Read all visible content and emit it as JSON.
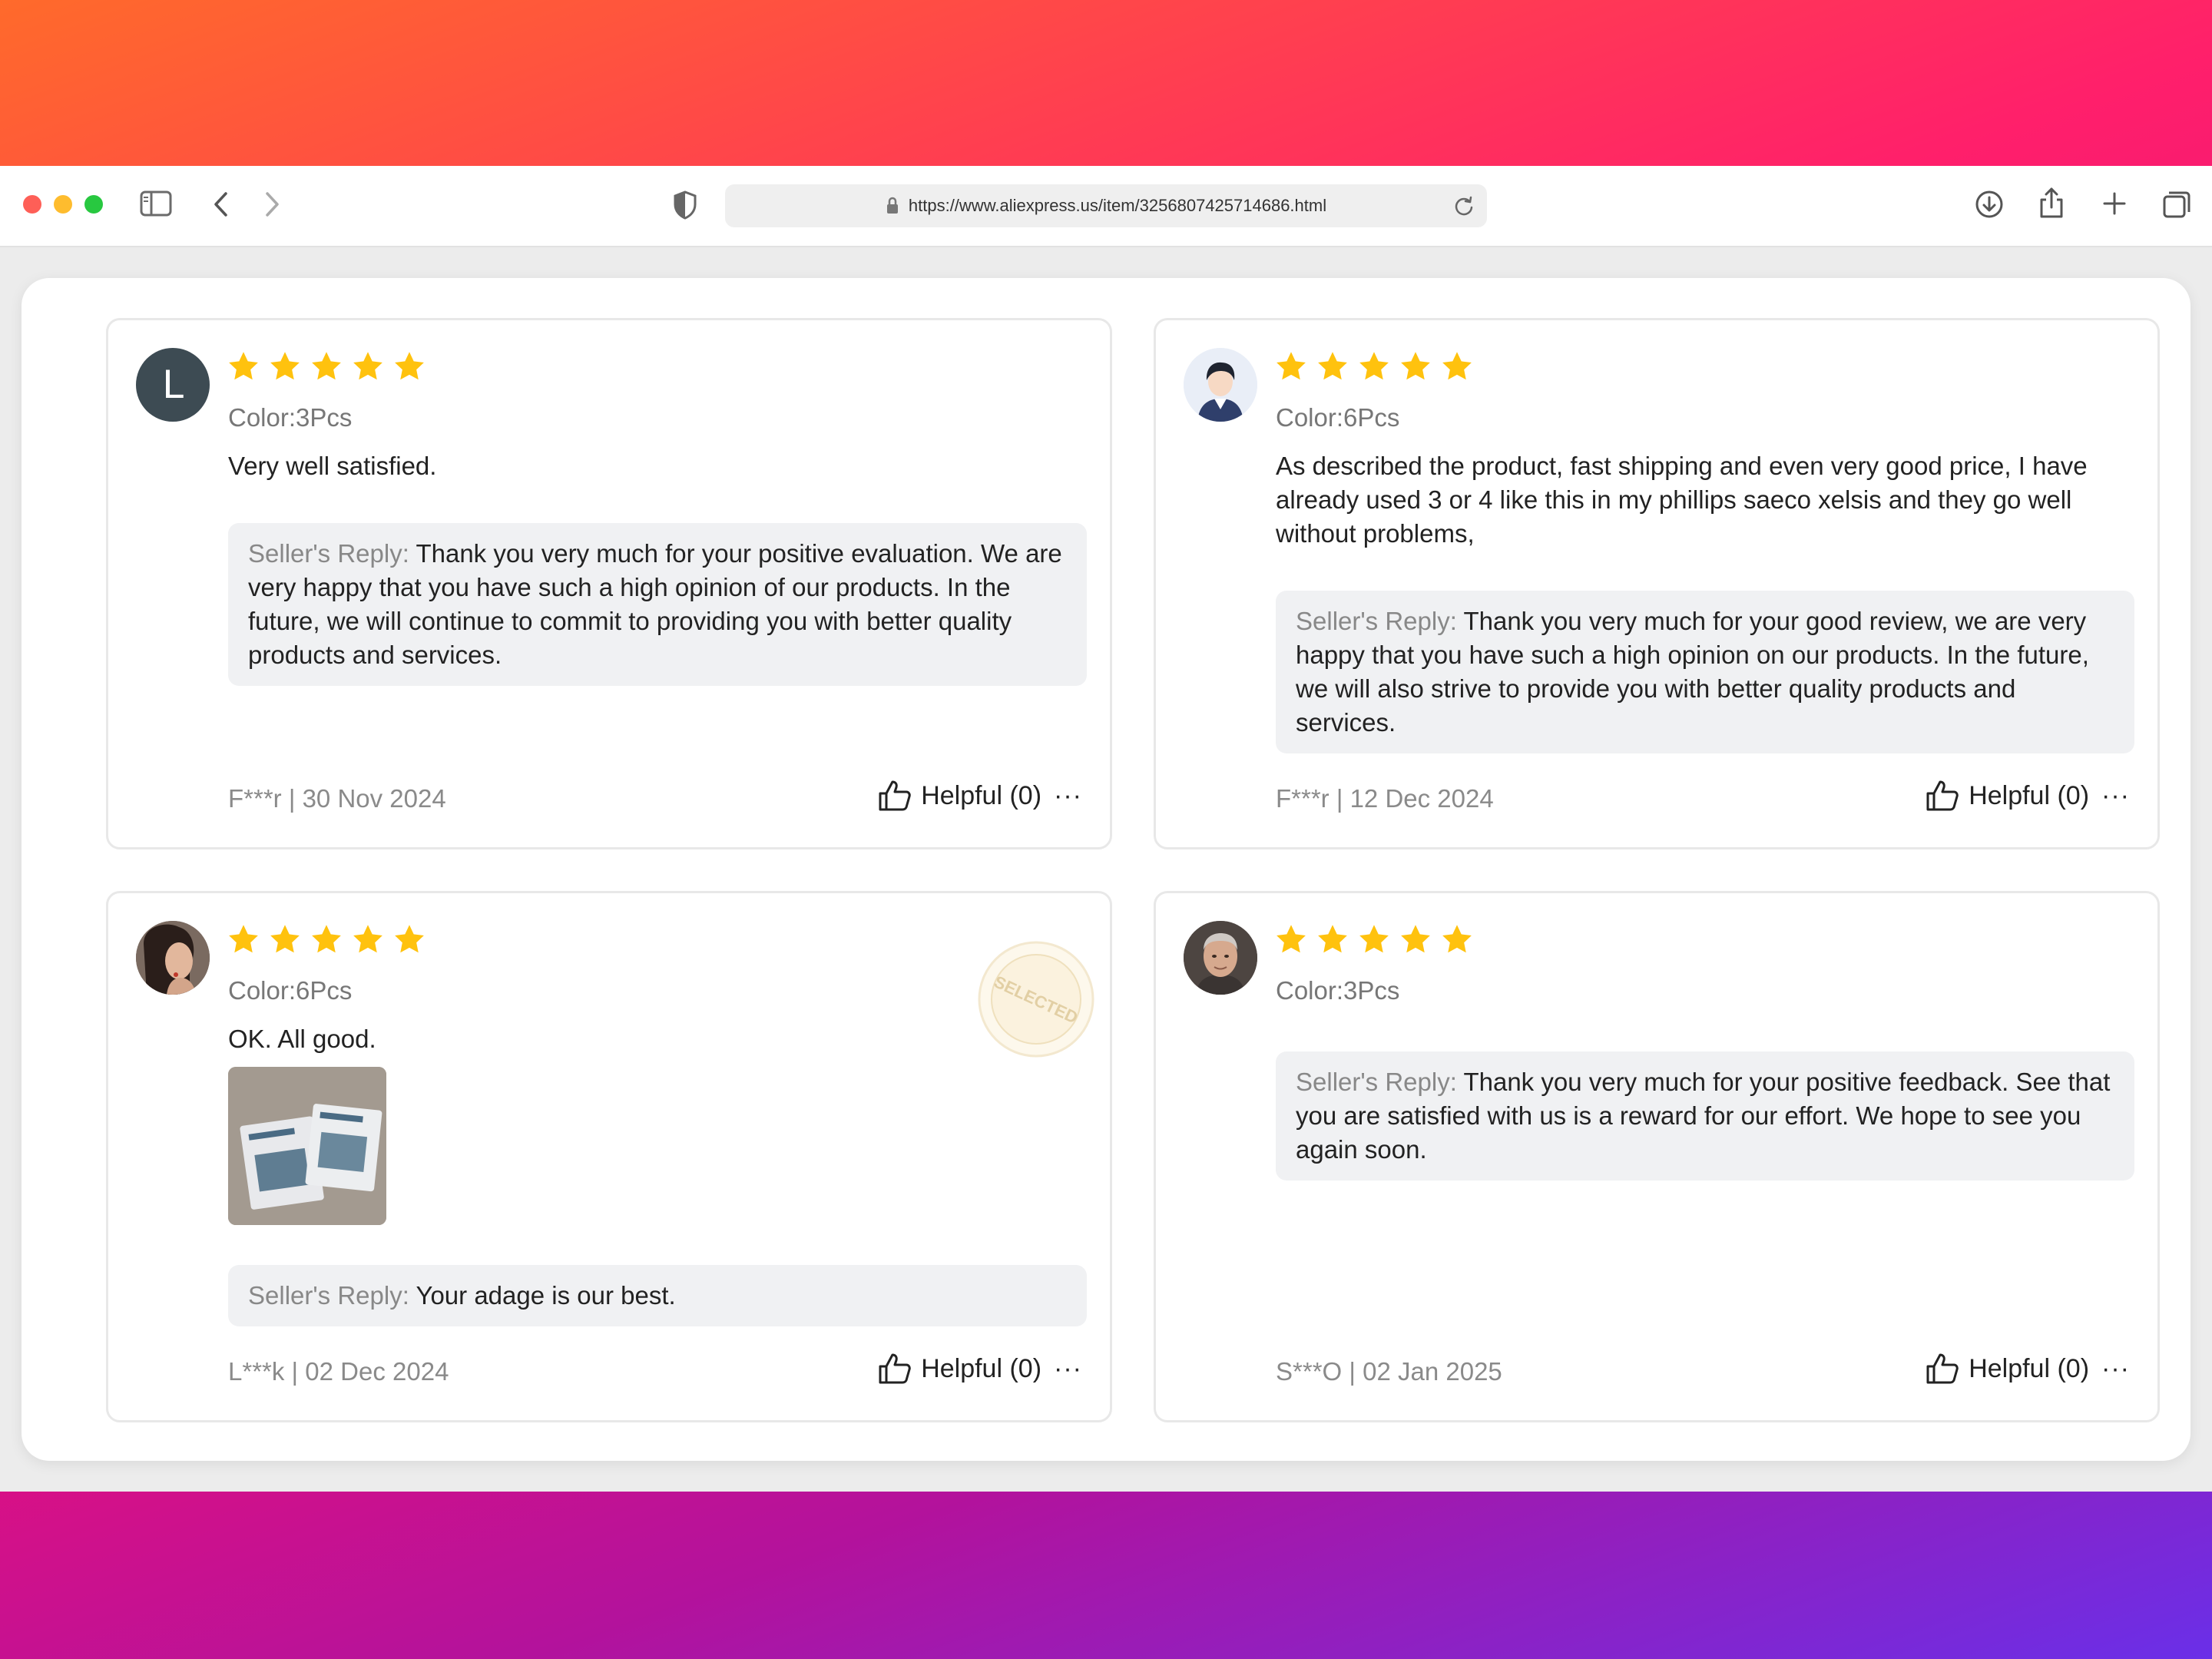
{
  "browser": {
    "url": "https://www.aliexpress.us/item/3256807425714686.html"
  },
  "colors": {
    "star": "#ffc20e",
    "reply_bg": "#f0f1f3",
    "avatar_letter_bg": "#3d4b53"
  },
  "reviews": [
    {
      "avatar_letter": "L",
      "rating": 5,
      "color": "Color:3Pcs",
      "text": "Very well satisfied.",
      "reply_label": "Seller's Reply:",
      "reply_text": "Thank you very much for your positive evaluation. We are very happy that you have such a high opinion of our products. In the future, we will continue to commit to providing you with better quality products and services.",
      "meta": "F***r | 30 Nov 2024",
      "helpful": "Helpful (0)",
      "more": "···"
    },
    {
      "avatar_icon": "user-avatar-icon",
      "rating": 5,
      "color": "Color:6Pcs",
      "text": "As described the product, fast shipping and even very good price, I have already used 3 or 4 like this in my phillips saeco xelsis and they go well without problems,",
      "reply_label": "Seller's Reply:",
      "reply_text": "Thank you very much for your good review, we are very happy that you have such a high opinion on our products. In the future, we will also strive to provide you with better quality products and services.",
      "meta": "F***r | 12 Dec 2024",
      "helpful": "Helpful (0)",
      "more": "···"
    },
    {
      "avatar_icon": "user-photo-avatar",
      "rating": 5,
      "color": "Color:6Pcs",
      "text": "OK. All good.",
      "badge": "SELECTED",
      "reply_label": "Seller's Reply:",
      "reply_text": "Your adage is our best.",
      "meta": "L***k | 02 Dec 2024",
      "helpful": "Helpful (0)",
      "more": "···"
    },
    {
      "avatar_icon": "user-photo-avatar",
      "rating": 5,
      "color": "Color:3Pcs",
      "text": "",
      "reply_label": "Seller's Reply:",
      "reply_text": "Thank you very much for your positive feedback. See that you are satisfied with us is a reward for our effort. We hope to see you again soon.",
      "meta": "S***O | 02 Jan 2025",
      "helpful": "Helpful (0)",
      "more": "···"
    }
  ]
}
